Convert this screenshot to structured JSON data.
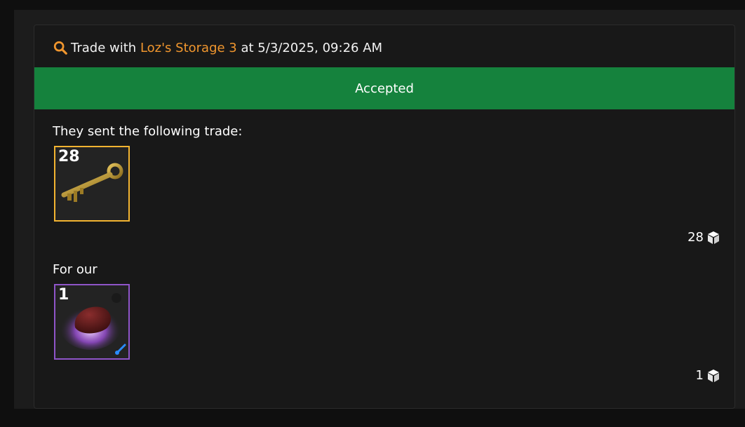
{
  "header": {
    "prefix": "Trade with",
    "partner_name": "Loz's Storage 3",
    "suffix": "at 5/3/2025, 09:26 AM",
    "icon": "search-icon"
  },
  "status": {
    "label": "Accepted",
    "color": "#15823d"
  },
  "sent": {
    "label": "They sent the following trade:",
    "items": [
      {
        "quantity": "28",
        "icon": "mann-co-key-icon",
        "border_color": "#f3b431"
      }
    ],
    "total": "28",
    "total_icon": "cube-icon"
  },
  "received": {
    "label": "For our",
    "items": [
      {
        "quantity": "1",
        "icon": "unusual-hat-icon",
        "border_color": "#8f55c9",
        "badge_icon": "paint-brush-icon"
      }
    ],
    "total": "1",
    "total_icon": "cube-icon"
  }
}
